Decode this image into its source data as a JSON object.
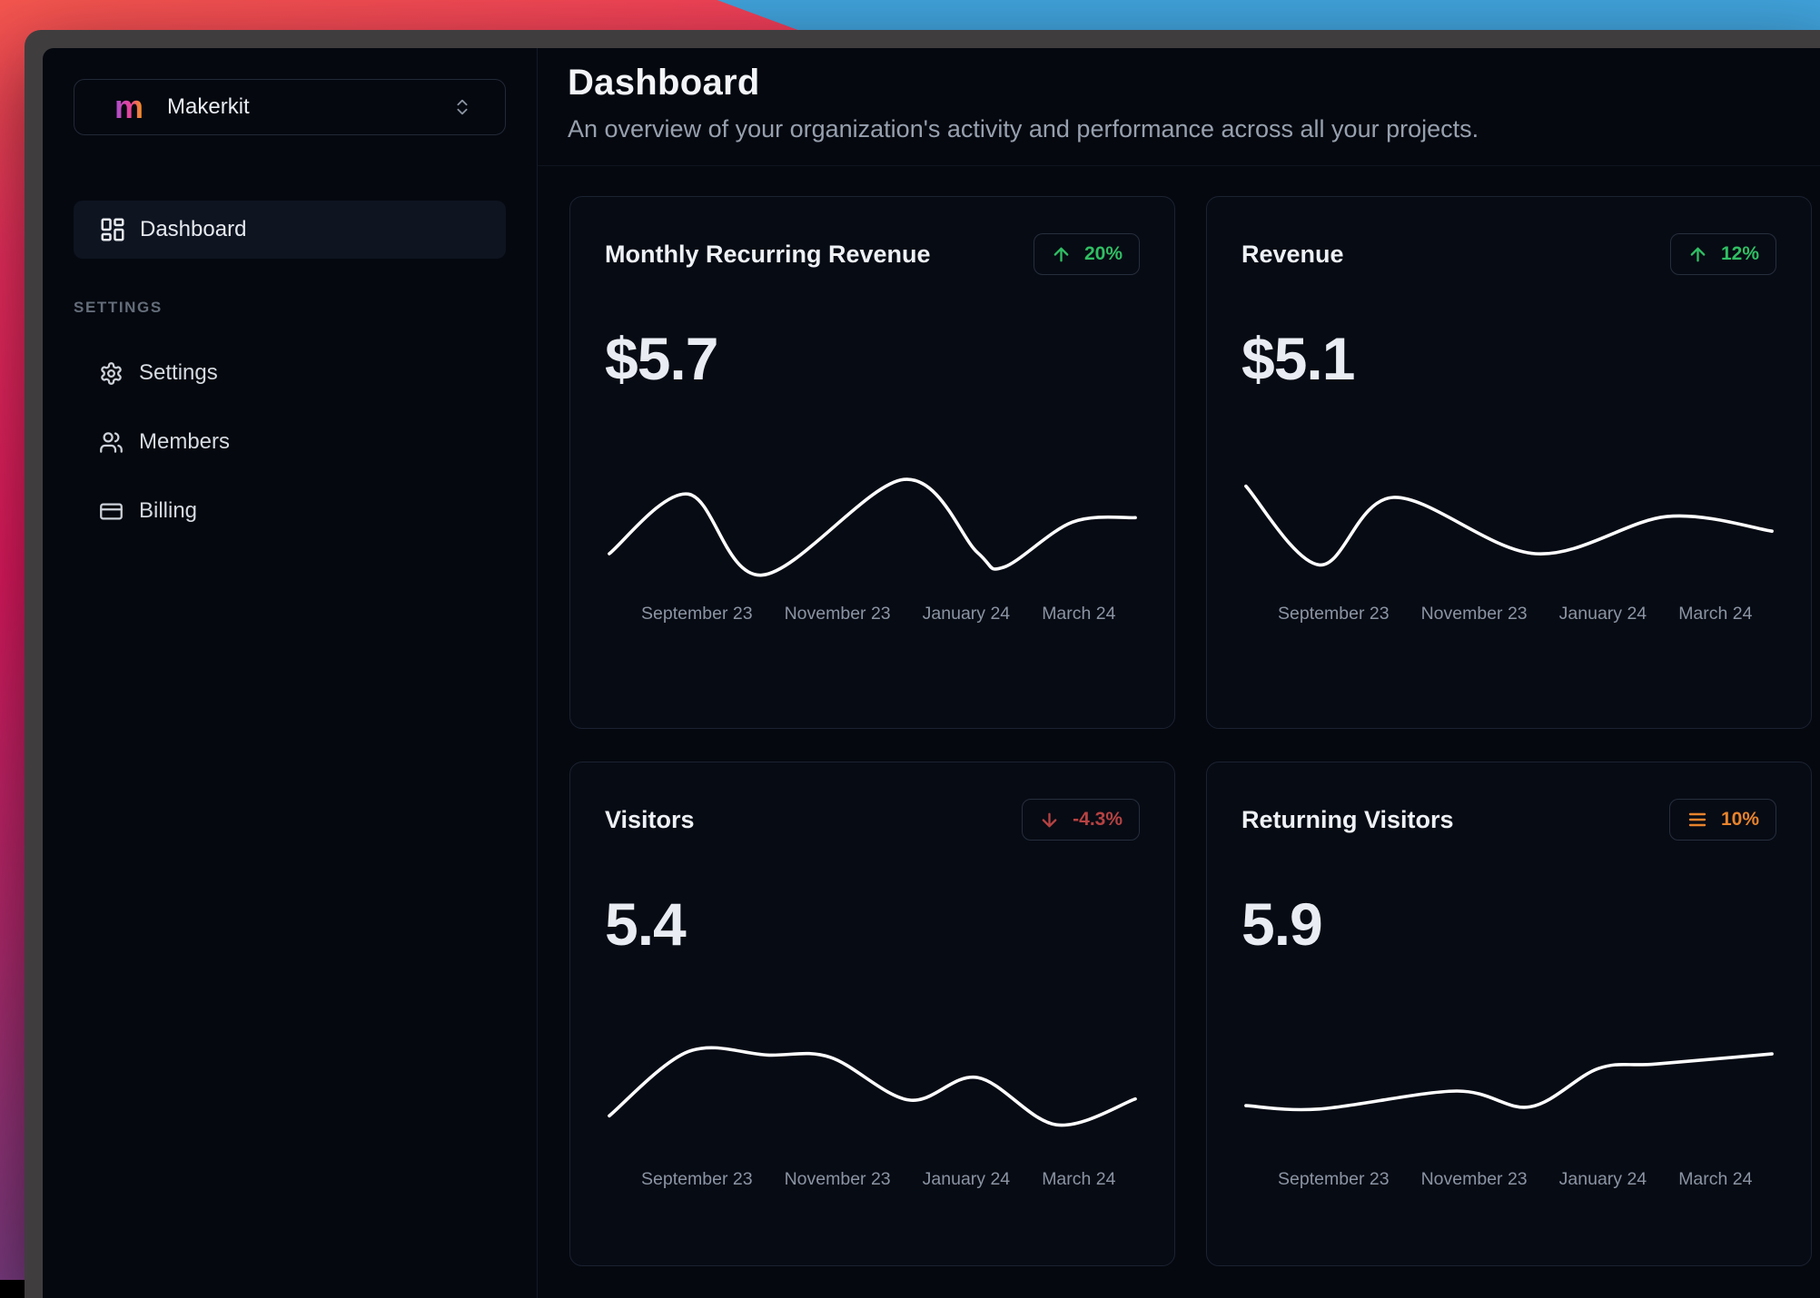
{
  "brand": {
    "logo_letter": "m",
    "name": "Makerkit"
  },
  "sidebar": {
    "nav_items": [
      {
        "label": "Dashboard",
        "icon": "layout-dashboard",
        "active": true
      }
    ],
    "section_label": "SETTINGS",
    "settings_items": [
      {
        "label": "Settings",
        "icon": "gear"
      },
      {
        "label": "Members",
        "icon": "users"
      },
      {
        "label": "Billing",
        "icon": "credit-card"
      }
    ]
  },
  "header": {
    "title": "Dashboard",
    "subtitle": "An overview of your organization's activity and performance across all your projects."
  },
  "colors": {
    "app_background": "#05080f",
    "card_background": "#070b14",
    "card_border": "#1b2231",
    "trend_up": "#30bf63",
    "trend_down": "#b64242",
    "trend_neutral": "#e8832c",
    "chart_line": "#ffffff",
    "wallpaper_pink": "#ee2f5f",
    "wallpaper_blue": "#41a3dc",
    "window_frame": "#403d3f",
    "logo_gradient": [
      "#a54fd0",
      "#e8439a",
      "#f59e0b"
    ]
  },
  "chart_data": [
    {
      "type": "line",
      "title": "Monthly Recurring Revenue",
      "metric_value": "$5.7",
      "trend": {
        "direction": "up",
        "label": "20%"
      },
      "categories": [
        "September 23",
        "November 23",
        "January 24",
        "March 24"
      ],
      "y_axis": "hidden",
      "legend": "none",
      "series": [
        {
          "name": "Monthly Recurring Revenue",
          "points": [
            [
              0,
              25
            ],
            [
              15,
              78
            ],
            [
              29,
              6
            ],
            [
              56,
              91
            ],
            [
              70,
              26
            ],
            [
              75,
              13
            ],
            [
              88,
              53
            ],
            [
              100,
              57
            ]
          ]
        }
      ]
    },
    {
      "type": "line",
      "title": "Revenue",
      "metric_value": "$5.1",
      "trend": {
        "direction": "up",
        "label": "12%"
      },
      "categories": [
        "September 23",
        "November 23",
        "January 24",
        "March 24"
      ],
      "y_axis": "hidden",
      "legend": "none",
      "series": [
        {
          "name": "Revenue",
          "points": [
            [
              0,
              85
            ],
            [
              14,
              15
            ],
            [
              28,
              75
            ],
            [
              55,
              25
            ],
            [
              80,
              58
            ],
            [
              100,
              45
            ]
          ]
        }
      ]
    },
    {
      "type": "line",
      "title": "Visitors",
      "metric_value": "5.4",
      "trend": {
        "direction": "down",
        "label": "-4.3%"
      },
      "categories": [
        "September 23",
        "November 23",
        "January 24",
        "March 24"
      ],
      "y_axis": "hidden",
      "legend": "none",
      "series": [
        {
          "name": "Visitors",
          "points": [
            [
              0,
              28
            ],
            [
              15,
              85
            ],
            [
              30,
              82
            ],
            [
              42,
              80
            ],
            [
              57,
              42
            ],
            [
              70,
              62
            ],
            [
              85,
              20
            ],
            [
              100,
              43
            ]
          ]
        }
      ]
    },
    {
      "type": "line",
      "title": "Returning Visitors",
      "metric_value": "5.9",
      "trend": {
        "direction": "neutral",
        "label": "10%"
      },
      "categories": [
        "September 23",
        "November 23",
        "January 24",
        "March 24"
      ],
      "y_axis": "hidden",
      "legend": "none",
      "series": [
        {
          "name": "Returning Visitors",
          "points": [
            [
              0,
              37
            ],
            [
              14,
              34
            ],
            [
              40,
              50
            ],
            [
              54,
              36
            ],
            [
              67,
              70
            ],
            [
              78,
              74
            ],
            [
              100,
              83
            ]
          ]
        }
      ]
    }
  ]
}
